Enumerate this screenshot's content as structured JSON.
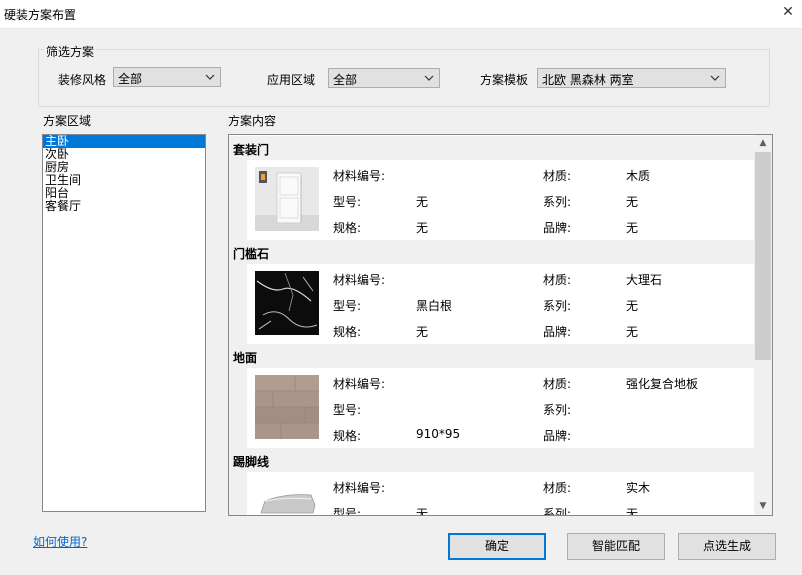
{
  "window": {
    "title": "硬装方案布置",
    "close_label": "✕"
  },
  "filter": {
    "legend": "筛选方案",
    "style_label": "装修风格",
    "style_value": "全部",
    "area_label": "应用区域",
    "area_value": "全部",
    "template_label": "方案模板",
    "template_value": "北欧 黑森林 两室"
  },
  "area_panel": {
    "title": "方案区域",
    "items": [
      "主卧",
      "次卧",
      "厨房",
      "卫生间",
      "阳台",
      "客餐厅"
    ],
    "selected_index": 0
  },
  "content_panel": {
    "title": "方案内容",
    "categories": [
      {
        "name": "套装门",
        "code_label": "材料编号:",
        "code": "",
        "material_label": "材质:",
        "material": "木质",
        "model_label": "型号:",
        "model": "无",
        "series_label": "系列:",
        "series": "无",
        "spec_label": "规格:",
        "spec": "无",
        "brand_label": "品牌:",
        "brand": "无"
      },
      {
        "name": "门槛石",
        "code_label": "材料编号:",
        "code": "",
        "material_label": "材质:",
        "material": "大理石",
        "model_label": "型号:",
        "model": "黑白根",
        "series_label": "系列:",
        "series": "无",
        "spec_label": "规格:",
        "spec": "无",
        "brand_label": "品牌:",
        "brand": "无"
      },
      {
        "name": "地面",
        "code_label": "材料编号:",
        "code": "",
        "material_label": "材质:",
        "material": "强化复合地板",
        "model_label": "型号:",
        "model": "",
        "series_label": "系列:",
        "series": "",
        "spec_label": "规格:",
        "spec": "910*95",
        "brand_label": "品牌:",
        "brand": ""
      },
      {
        "name": "踢脚线",
        "code_label": "材料编号:",
        "code": "",
        "material_label": "材质:",
        "material": "实木",
        "model_label": "型号:",
        "model": "无",
        "series_label": "系列:",
        "series": "无",
        "spec_label": "",
        "spec": "",
        "brand_label": "",
        "brand": ""
      }
    ],
    "thumb_icons": [
      "door-thumbnail",
      "black-marble-thumbnail",
      "wood-floor-thumbnail",
      "baseboard-thumbnail"
    ]
  },
  "footer": {
    "help_link": "如何使用?",
    "ok_label": "确定",
    "smart_match_label": "智能匹配",
    "generate_label": "点选生成"
  },
  "colors": {
    "selection": "#0078d7",
    "link": "#0066cc",
    "default_button_border": "#0078d7"
  }
}
